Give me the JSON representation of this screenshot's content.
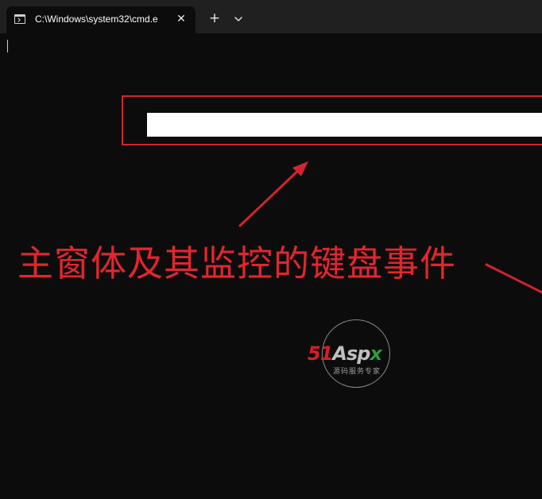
{
  "tab": {
    "title": "C:\\Windows\\system32\\cmd.e",
    "close_glyph": "✕",
    "icon": "terminal-icon"
  },
  "titlebar": {
    "new_tab_glyph": "+",
    "dropdown_icon": "chevron-down-icon"
  },
  "annotation": {
    "text": "主窗体及其监控的键盘事件",
    "color": "#e3252e"
  },
  "watermark": {
    "part_51": "51",
    "part_asp": "Asp",
    "part_x": "x",
    "subtitle": "源码服务专家"
  },
  "colors": {
    "background": "#0c0c0c",
    "titlebar": "#202020",
    "annotation_red": "#d0252f",
    "input_white": "#ffffff"
  }
}
